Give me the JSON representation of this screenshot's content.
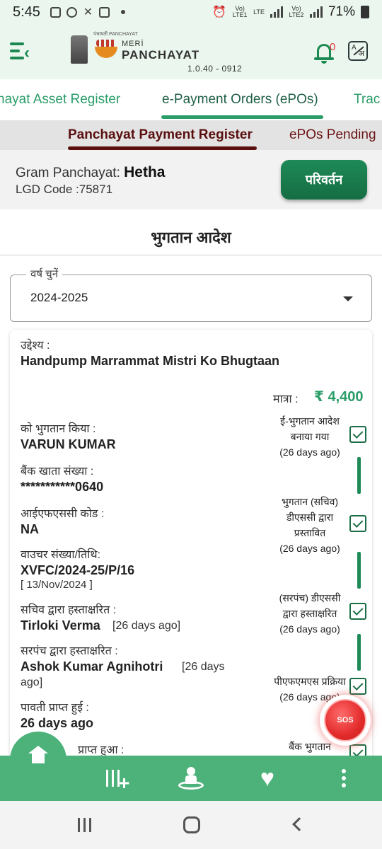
{
  "status_bar": {
    "time": "5:45",
    "sim1_label": "Vo) LTE1",
    "lte_label": "LTE",
    "sim2_label": "Vo) LTE2",
    "battery": "71%"
  },
  "header": {
    "logo_small": "पंचायती PANCHAYAT",
    "logo_meri": "MERİ",
    "logo_title": "PANCHAYAT",
    "version": "1.0.40 - 0912",
    "notification_count": "0",
    "lang_a": "A",
    "lang_b": "अ"
  },
  "top_tabs": [
    {
      "label": "hayat Asset Register"
    },
    {
      "label": "e-Payment Orders (ePOs)"
    },
    {
      "label": "Trac"
    }
  ],
  "sub_tabs": [
    {
      "label": "Panchayat Payment Register"
    },
    {
      "label": "ePOs Pending"
    }
  ],
  "panchayat": {
    "gp_label": "Gram Panchayat:",
    "gp_name": "Hetha",
    "lgd_text": "LGD Code :75871",
    "change_label": "परिवर्तन"
  },
  "section": {
    "title": "भुगतान आदेश",
    "year_legend": "वर्ष चुनें",
    "year_value": "2024-2025"
  },
  "order": {
    "purpose_label": "उद्देश्य :",
    "purpose_value": "Handpump Marrammat Mistri Ko Bhugtaan",
    "amount_label": "मात्रा :",
    "amount_value": "₹ 4,400",
    "paid_to_label": "को भुगतान किया :",
    "paid_to_value": "VARUN KUMAR",
    "account_label": "बैंक खाता संख्या :",
    "account_value": "***********0640",
    "ifsc_label": "आईएफएससी कोड :",
    "ifsc_value": "NA",
    "voucher_label": "वाउचर संख्या/तिथि:",
    "voucher_value": "XVFC/2024-25/P/16",
    "voucher_date": "[ 13/Nov/2024 ]",
    "secretary_label": "सचिव द्वारा हस्ताक्षरित :",
    "secretary_value": "Tirloki Verma",
    "secretary_note": "[26 days ago]",
    "sarpanch_label": "सरपंच द्वारा हस्ताक्षरित :",
    "sarpanch_value": "Ashok Kumar Agnihotri",
    "sarpanch_note1": "[26 days",
    "sarpanch_note2": "ago]",
    "receipt_label": "पावती प्राप्त हुई :",
    "receipt_value": "26 days ago",
    "next_label": "प्राप्त हुआ :"
  },
  "timeline": [
    {
      "line1": "ई-भुगतान आदेश",
      "line2": "बनाया गया",
      "line3": "(26 days ago)"
    },
    {
      "line1": "भुगतान (सचिव)",
      "line2": "डीएससी द्वारा",
      "line3": "प्रस्तावित",
      "line4": "(26 days ago)"
    },
    {
      "line1": "(सरपंच) डीएससी",
      "line2": "द्वारा हस्ताक्षरित",
      "line3": "(26 days ago)"
    },
    {
      "line1": "पीएफएमएस प्रक्रिया",
      "line2": "(26 days ago)"
    },
    {
      "line1": "बैंक भुगतान"
    }
  ],
  "sos_label": "SOS",
  "bottom_nav": {
    "icons": [
      "home-icon",
      "filter-icon",
      "person-location-icon",
      "heart-icon",
      "more-icon"
    ]
  },
  "colors": {
    "primary_green": "#1e8a57",
    "nav_green": "#4cb27a",
    "amount_green": "#2a9d68",
    "maroon": "#5a0f0f",
    "sos_red": "#e32b2b"
  }
}
